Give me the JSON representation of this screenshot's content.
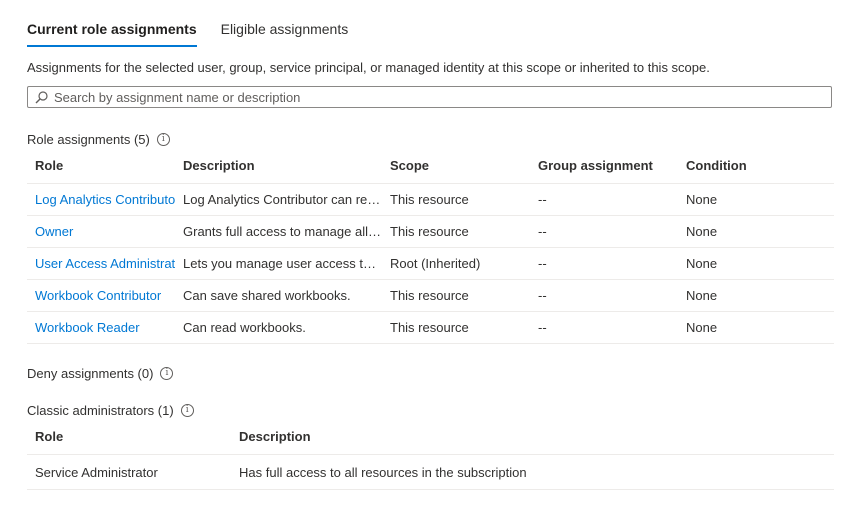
{
  "tabs": [
    {
      "label": "Current role assignments",
      "active": true
    },
    {
      "label": "Eligible assignments",
      "active": false
    }
  ],
  "description": "Assignments for the selected user, group, service principal, or managed identity at this scope or inherited to this scope.",
  "search": {
    "placeholder": "Search by assignment name or description",
    "value": ""
  },
  "role_assignments": {
    "title": "Role assignments (5)",
    "columns": [
      "Role",
      "Description",
      "Scope",
      "Group assignment",
      "Condition"
    ],
    "rows": [
      {
        "role": "Log Analytics Contributor",
        "description": "Log Analytics Contributor can read all monitoring data",
        "scope": "This resource",
        "group": "--",
        "condition": "None"
      },
      {
        "role": "Owner",
        "description": "Grants full access to manage all resources",
        "scope": "This resource",
        "group": "--",
        "condition": "None"
      },
      {
        "role": "User Access Administrator",
        "description": "Lets you manage user access to Azure resources",
        "scope": "Root (Inherited)",
        "group": "--",
        "condition": "None"
      },
      {
        "role": "Workbook Contributor",
        "description": "Can save shared workbooks.",
        "scope": "This resource",
        "group": "--",
        "condition": "None"
      },
      {
        "role": "Workbook Reader",
        "description": "Can read workbooks.",
        "scope": "This resource",
        "group": "--",
        "condition": "None"
      }
    ]
  },
  "deny_assignments": {
    "title": "Deny assignments (0)"
  },
  "classic_admins": {
    "title": "Classic administrators (1)",
    "columns": [
      "Role",
      "Description"
    ],
    "rows": [
      {
        "role": "Service Administrator",
        "description": "Has full access to all resources in the subscription"
      }
    ]
  },
  "colors": {
    "accent": "#0078d4",
    "text": "#323130",
    "border": "#edebe9"
  },
  "icons": {
    "search": "search-icon",
    "info": "info-icon"
  }
}
